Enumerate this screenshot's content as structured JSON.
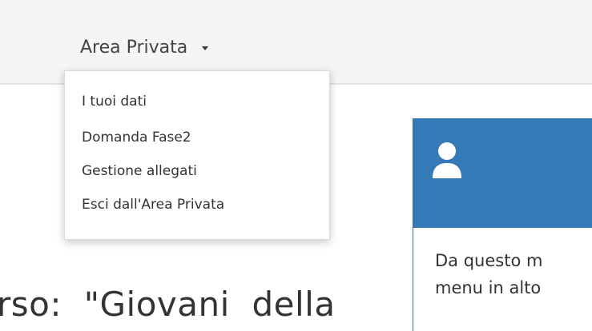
{
  "navbar": {
    "area_privata_label": "Area Privata"
  },
  "dropdown": {
    "items": [
      {
        "label": "I tuoi dati"
      },
      {
        "label": "Domanda Fase2"
      },
      {
        "label": "Gestione allegati"
      },
      {
        "label": "Esci dall'Area Privata"
      }
    ]
  },
  "panel": {
    "icon": "user-icon",
    "body_lines": [
      "Da questo m",
      "menu in alto"
    ]
  },
  "main": {
    "heading_fragment": "rso:  \"Giovani  della"
  },
  "colors": {
    "panel_heading": "#337ab7",
    "navbar_bg": "#f5f5f5"
  }
}
